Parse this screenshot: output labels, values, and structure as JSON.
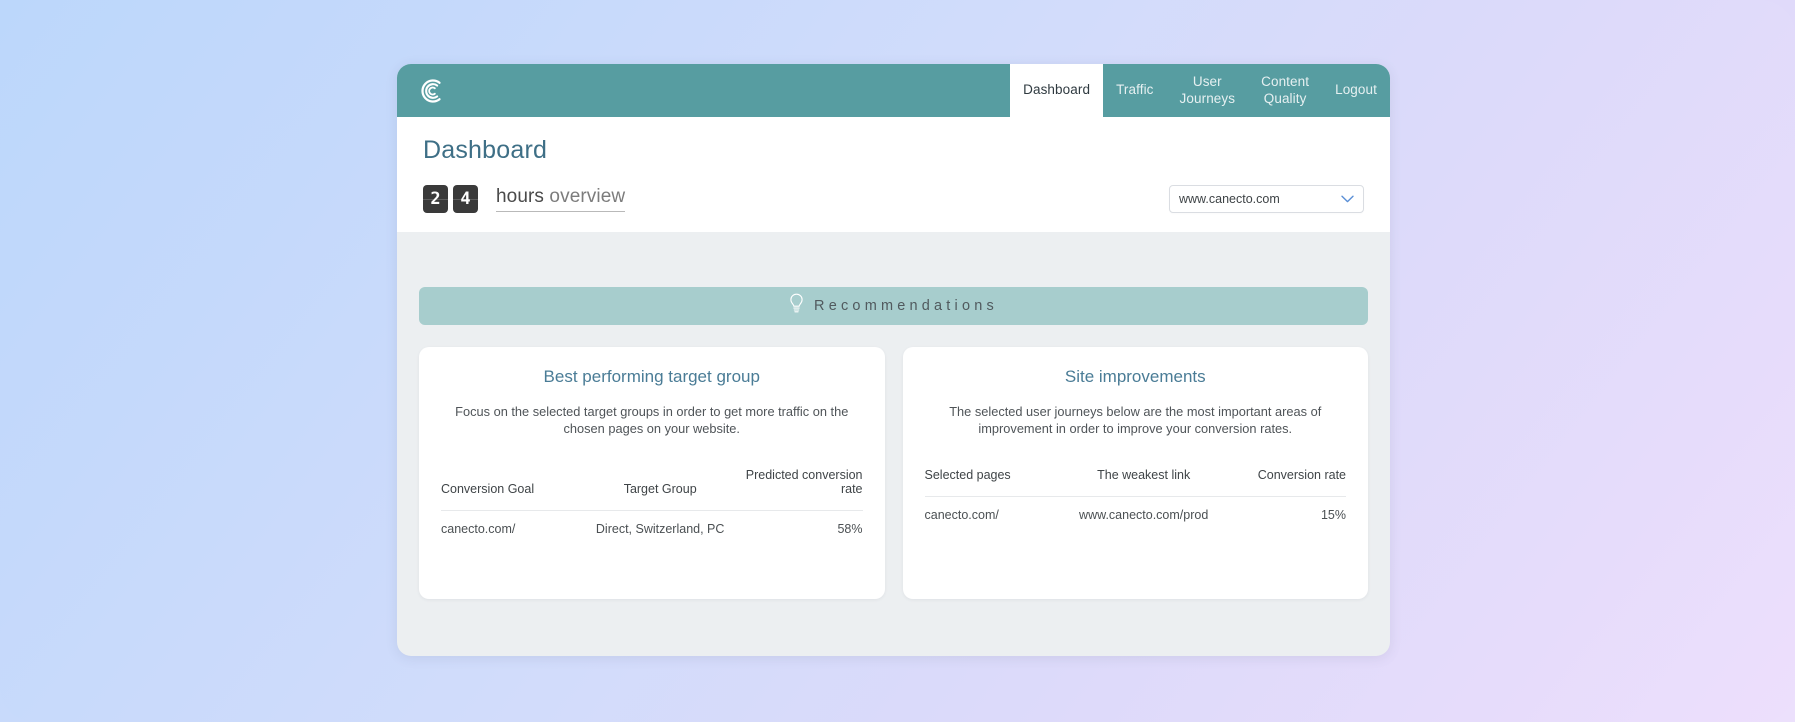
{
  "app": {
    "brand_icon": "canecto-c-logo-icon",
    "nav": [
      {
        "label": "Dashboard",
        "active": true
      },
      {
        "label": "Traffic",
        "active": false
      },
      {
        "label": "User\nJourneys",
        "active": false
      },
      {
        "label": "Content\nQuality",
        "active": false
      },
      {
        "label": "Logout",
        "active": false
      }
    ]
  },
  "header": {
    "page_title": "Dashboard",
    "overview": {
      "digit_1": "2",
      "digit_2": "4",
      "unit": "hours",
      "suffix": "overview"
    },
    "site_select": {
      "value": "www.canecto.com",
      "caret_icon": "chevron-down-icon"
    }
  },
  "recommendations_banner": {
    "icon": "lightbulb-icon",
    "label": "Recommendations"
  },
  "cards": [
    {
      "title": "Best performing target group",
      "description": "Focus on the selected target groups in order to get more traffic on the chosen pages on your website.",
      "columns": [
        "Conversion Goal",
        "Target Group",
        "Predicted conversion rate"
      ],
      "rows": [
        {
          "c1": "canecto.com/",
          "c2": "Direct, Switzerland, PC",
          "c3": "58%"
        }
      ]
    },
    {
      "title": "Site improvements",
      "description": "The selected user journeys below are the most important areas of improvement in order to improve your conversion rates.",
      "columns": [
        "Selected pages",
        "The weakest link",
        "Conversion rate"
      ],
      "rows": [
        {
          "c1": "canecto.com/",
          "c2": "www.canecto.com/prod",
          "c3": "15%"
        }
      ]
    }
  ],
  "colors": {
    "teal_header": "#579da1",
    "banner_teal": "#a7cdcd",
    "card_title_blue": "#4a7c96",
    "page_title_blue": "#3e6f86",
    "content_grey": "#eceff1",
    "backdrop_start": "#bcd7fb",
    "backdrop_end": "#ece0fc"
  }
}
